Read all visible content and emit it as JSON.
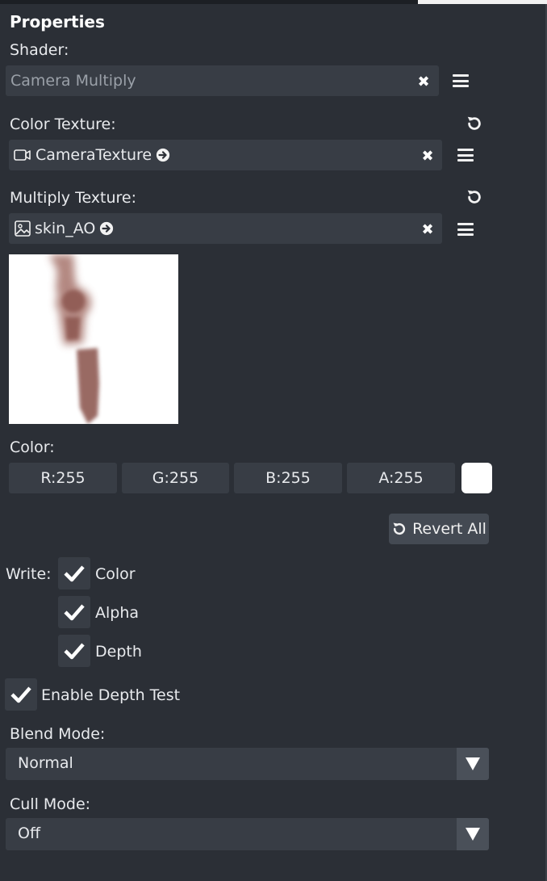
{
  "panel": {
    "title": "Properties"
  },
  "shader": {
    "label": "Shader:",
    "value": "Camera Multiply"
  },
  "color_texture": {
    "label": "Color Texture:",
    "value": "CameraTexture"
  },
  "multiply_texture": {
    "label": "Multiply Texture:",
    "value": "skin_AO"
  },
  "color": {
    "label": "Color:",
    "r": "R:255",
    "g": "G:255",
    "b": "B:255",
    "a": "A:255",
    "swatch_color": "#ffffff"
  },
  "revert_all_label": "Revert All",
  "write": {
    "label": "Write:",
    "options": [
      {
        "label": "Color",
        "checked": true
      },
      {
        "label": "Alpha",
        "checked": true
      },
      {
        "label": "Depth",
        "checked": true
      }
    ]
  },
  "enable_depth_test": {
    "label": "Enable Depth Test",
    "checked": true
  },
  "blend_mode": {
    "label": "Blend Mode:",
    "value": "Normal"
  },
  "cull_mode": {
    "label": "Cull Mode:",
    "value": "Off"
  },
  "icons": {
    "clear": "x-icon",
    "menu": "hamburger-menu-icon",
    "revert": "revert-icon",
    "camera": "camera-icon",
    "image": "image-icon",
    "goto": "arrow-circle-right-icon",
    "check": "checkmark-icon",
    "dropdown": "triangle-down-icon"
  }
}
